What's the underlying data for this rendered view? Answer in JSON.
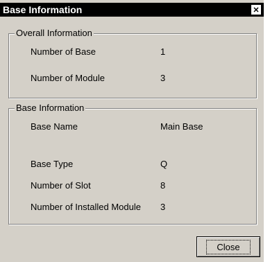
{
  "window": {
    "title": "Base Information",
    "close_glyph": "✕"
  },
  "overall": {
    "legend": "Overall Information",
    "rows": [
      {
        "label": "Number of Base",
        "value": "1"
      },
      {
        "label": "Number of Module",
        "value": "3"
      }
    ]
  },
  "base": {
    "legend": "Base Information",
    "rows": [
      {
        "label": "Base Name",
        "value": "Main Base"
      },
      {
        "label": "Base Type",
        "value": "Q"
      },
      {
        "label": "Number of Slot",
        "value": "8"
      },
      {
        "label": "Number of Installed Module",
        "value": "3"
      }
    ]
  },
  "buttons": {
    "close": "Close"
  }
}
